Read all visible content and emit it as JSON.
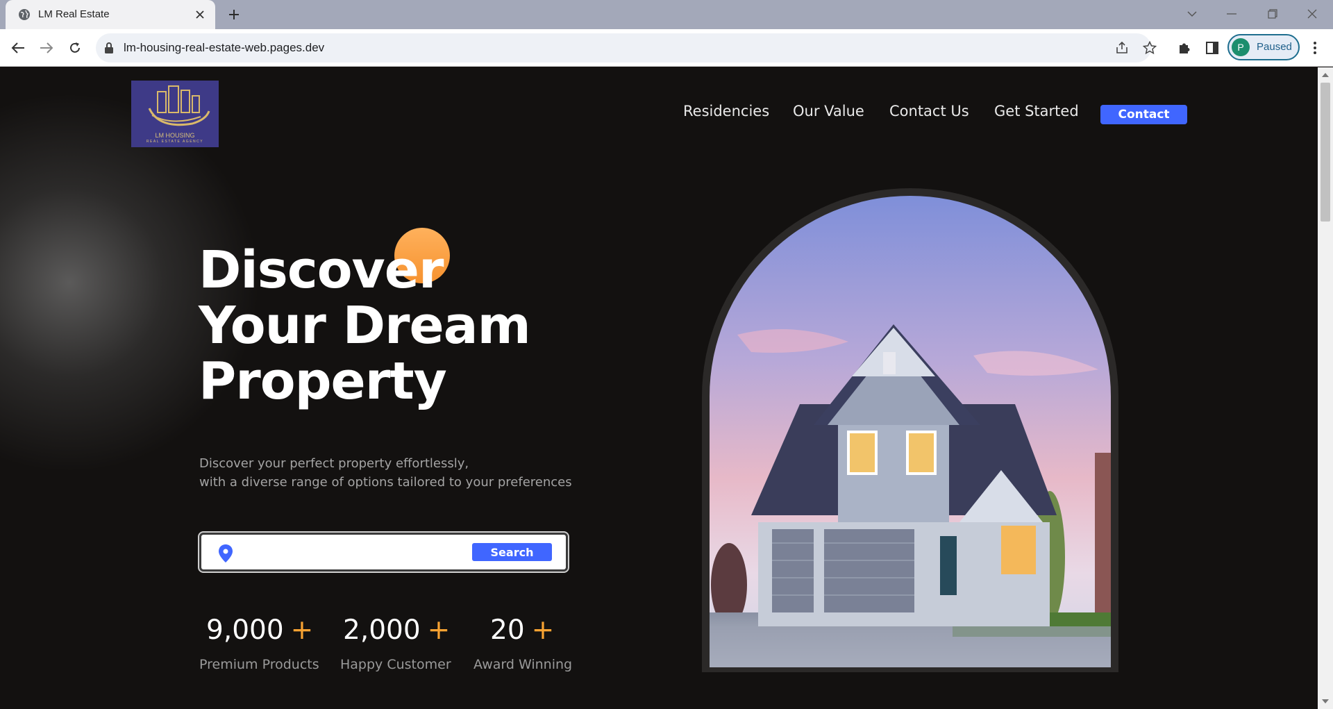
{
  "browser": {
    "tab_title": "LM Real Estate",
    "url": "lm-housing-real-estate-web.pages.dev",
    "profile_initial": "P",
    "profile_status": "Paused"
  },
  "header": {
    "logo_text": "LM HOUSING",
    "logo_subtext": "REAL ESTATE AGENCY",
    "nav": [
      "Residencies",
      "Our Value",
      "Contact Us",
      "Get Started"
    ],
    "contact_button": "Contact"
  },
  "hero": {
    "title_lines": [
      "Discover",
      "Your Dream",
      "Property"
    ],
    "description_lines": [
      "Discover your perfect property effortlessly,",
      "with a diverse range of options tailored to your preferences"
    ],
    "search": {
      "placeholder": "",
      "button": "Search"
    },
    "stats": [
      {
        "value": "9,000",
        "suffix": "+",
        "label": "Premium Products"
      },
      {
        "value": "2,000",
        "suffix": "+",
        "label": "Happy Customer"
      },
      {
        "value": "20",
        "suffix": "+",
        "label": "Award Winning"
      }
    ]
  },
  "colors": {
    "accent_blue": "#4066ff",
    "accent_orange": "#f7a232",
    "background": "#131110"
  }
}
